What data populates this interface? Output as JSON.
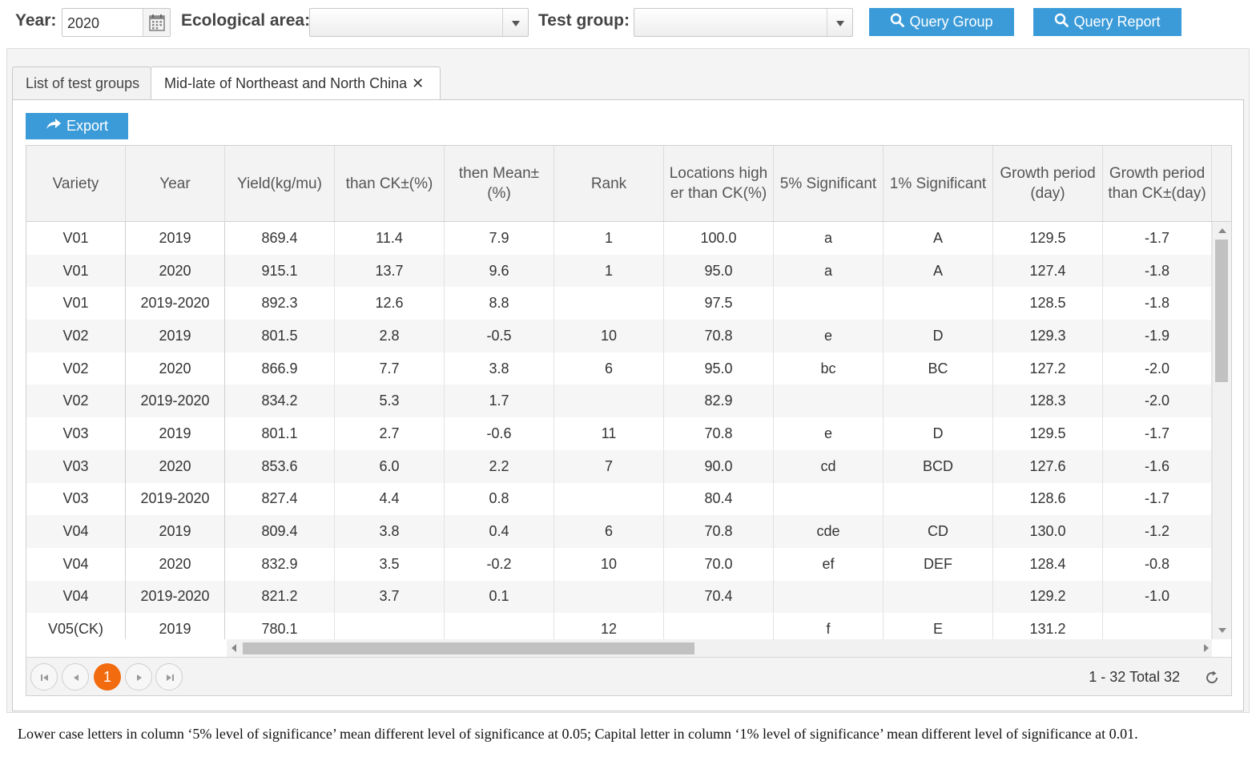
{
  "query": {
    "year_label": "Year:",
    "year_value": "2020",
    "eco_label": "Ecological area:",
    "eco_value": "",
    "group_label": "Test group:",
    "group_value": "",
    "query_group_label": "Query Group",
    "query_report_label": "Query Report"
  },
  "tabs": [
    {
      "label": "List of test groups"
    },
    {
      "label": "Mid-late of Northeast and North China"
    }
  ],
  "toolbar": {
    "export_label": "Export"
  },
  "table": {
    "headers": [
      "Variety",
      "Year",
      "Yield(kg/mu)",
      "than CK±(%)",
      "then Mean±(%)",
      "Rank",
      "Locations higher than CK(%)",
      "5% Significant",
      "1% Significant",
      "Growth period(day)",
      "Growth period than CK±(day)"
    ],
    "rows": [
      [
        "V01",
        "2019",
        "869.4",
        "11.4",
        "7.9",
        "1",
        "100.0",
        "a",
        "A",
        "129.5",
        "-1.7"
      ],
      [
        "V01",
        "2020",
        "915.1",
        "13.7",
        "9.6",
        "1",
        "95.0",
        "a",
        "A",
        "127.4",
        "-1.8"
      ],
      [
        "V01",
        "2019-2020",
        "892.3",
        "12.6",
        "8.8",
        "",
        "97.5",
        "",
        "",
        "128.5",
        "-1.8"
      ],
      [
        "V02",
        "2019",
        "801.5",
        "2.8",
        "-0.5",
        "10",
        "70.8",
        "e",
        "D",
        "129.3",
        "-1.9"
      ],
      [
        "V02",
        "2020",
        "866.9",
        "7.7",
        "3.8",
        "6",
        "95.0",
        "bc",
        "BC",
        "127.2",
        "-2.0"
      ],
      [
        "V02",
        "2019-2020",
        "834.2",
        "5.3",
        "1.7",
        "",
        "82.9",
        "",
        "",
        "128.3",
        "-2.0"
      ],
      [
        "V03",
        "2019",
        "801.1",
        "2.7",
        "-0.6",
        "11",
        "70.8",
        "e",
        "D",
        "129.5",
        "-1.7"
      ],
      [
        "V03",
        "2020",
        "853.6",
        "6.0",
        "2.2",
        "7",
        "90.0",
        "cd",
        "BCD",
        "127.6",
        "-1.6"
      ],
      [
        "V03",
        "2019-2020",
        "827.4",
        "4.4",
        "0.8",
        "",
        "80.4",
        "",
        "",
        "128.6",
        "-1.7"
      ],
      [
        "V04",
        "2019",
        "809.4",
        "3.8",
        "0.4",
        "6",
        "70.8",
        "cde",
        "CD",
        "130.0",
        "-1.2"
      ],
      [
        "V04",
        "2020",
        "832.9",
        "3.5",
        "-0.2",
        "10",
        "70.0",
        "ef",
        "DEF",
        "128.4",
        "-0.8"
      ],
      [
        "V04",
        "2019-2020",
        "821.2",
        "3.7",
        "0.1",
        "",
        "70.4",
        "",
        "",
        "129.2",
        "-1.0"
      ],
      [
        "V05(CK)",
        "2019",
        "780.1",
        "",
        "",
        "12",
        "",
        "f",
        "E",
        "131.2",
        ""
      ]
    ]
  },
  "pager": {
    "current_page": "1",
    "info": "1 - 32 Total 32"
  },
  "footnote": "Lower case letters in column ‘5% level of significance’ mean different level of significance at 0.05; Capital letter in column ‘1% level of significance’ mean different level of significance at 0.01.",
  "colors": {
    "accent": "#3b9bd9",
    "current_page": "#f26b0e"
  },
  "icons": [
    "calendar-icon",
    "dropdown-arrow-icon",
    "search-icon",
    "close-icon",
    "share-arrow-icon",
    "first-page-icon",
    "prev-page-icon",
    "next-page-icon",
    "last-page-icon",
    "refresh-icon"
  ]
}
